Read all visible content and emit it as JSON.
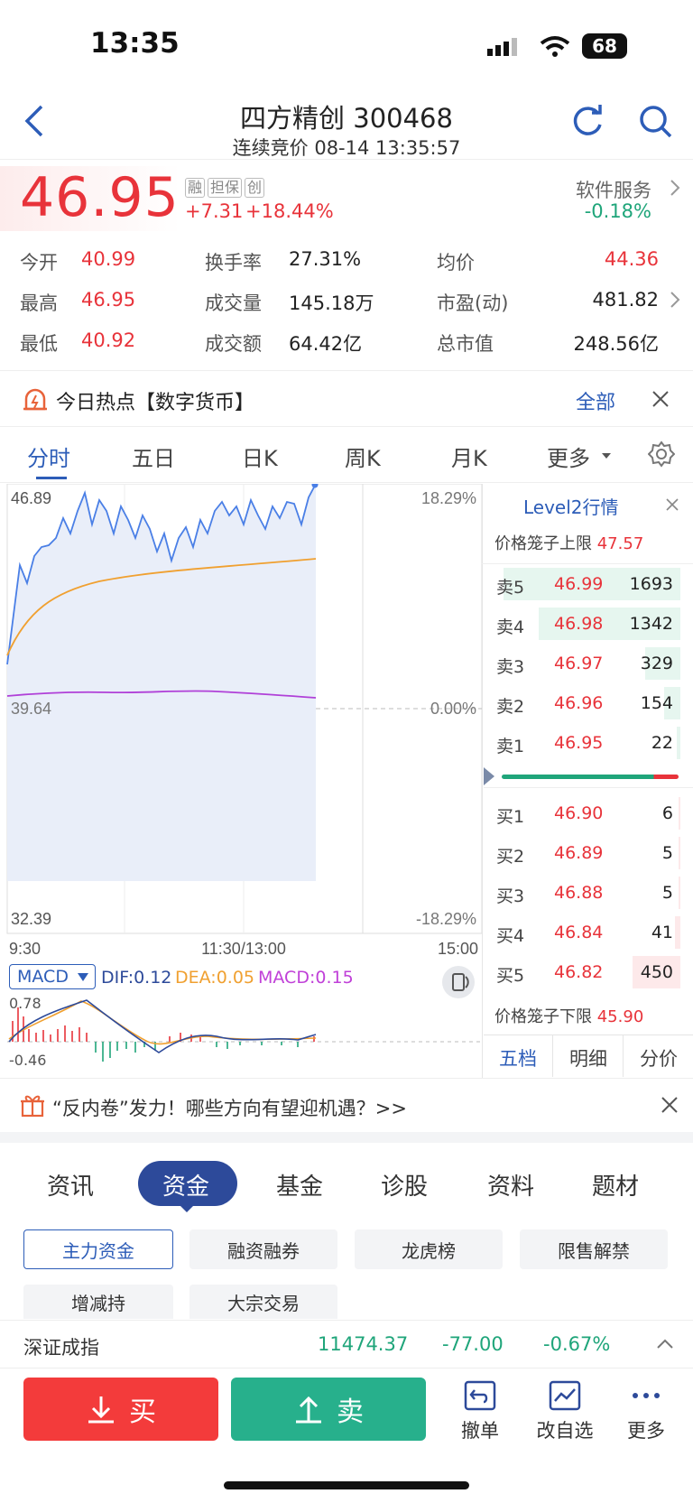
{
  "status_bar": {
    "time": "13:35",
    "battery": "68"
  },
  "header": {
    "title": "四方精创 300468",
    "subtitle": "连续竞价 08-14 13:35:57"
  },
  "quote": {
    "price": "46.95",
    "tags": [
      "融",
      "担保",
      "创"
    ],
    "change": "+7.31",
    "change_pct": "+18.44%",
    "sector": {
      "name": "软件服务",
      "change": "-0.18%"
    },
    "stats": [
      {
        "label": "今开",
        "value": "40.99"
      },
      {
        "label": "换手率",
        "value": "27.31%"
      },
      {
        "label": "均价",
        "value": "44.36"
      },
      {
        "label": "最高",
        "value": "46.95"
      },
      {
        "label": "成交量",
        "value": "145.18万"
      },
      {
        "label": "市盈(动)",
        "value": "481.82"
      },
      {
        "label": "最低",
        "value": "40.92"
      },
      {
        "label": "成交额",
        "value": "64.42亿"
      },
      {
        "label": "总市值",
        "value": "248.56亿"
      }
    ]
  },
  "hot": {
    "text": "今日热点【数字货币】",
    "all": "全部"
  },
  "chart_tabs": [
    "分时",
    "五日",
    "日K",
    "周K",
    "月K",
    "更多"
  ],
  "chart_data": {
    "type": "line",
    "title": "",
    "y_left": {
      "top": "46.89",
      "mid": "39.64",
      "bottom": "32.39"
    },
    "y_right": {
      "top": "18.29%",
      "mid": "0.00%",
      "bottom": "-18.29%"
    },
    "x_labels": [
      "9:30",
      "11:30/13:00",
      "15:00"
    ],
    "ylim": [
      32.39,
      46.89
    ],
    "series": []
  },
  "macd": {
    "selector": "MACD",
    "dif": "DIF:0.12",
    "dea": "DEA:0.05",
    "macd": "MACD:0.15",
    "top": "0.78",
    "bottom": "-0.46"
  },
  "orderbook": {
    "title": "Level2行情",
    "upper_limit_label": "价格笼子上限",
    "upper_limit": "47.57",
    "asks": [
      {
        "label": "卖5",
        "price": "46.99",
        "vol": "1693",
        "fill": 1.0
      },
      {
        "label": "卖4",
        "price": "46.98",
        "vol": "1342",
        "fill": 0.8
      },
      {
        "label": "卖3",
        "price": "46.97",
        "vol": "329",
        "fill": 0.2
      },
      {
        "label": "卖2",
        "price": "46.96",
        "vol": "154",
        "fill": 0.09
      },
      {
        "label": "卖1",
        "price": "46.95",
        "vol": "22",
        "fill": 0.02
      }
    ],
    "bids": [
      {
        "label": "买1",
        "price": "46.90",
        "vol": "6",
        "fill": 0.01
      },
      {
        "label": "买2",
        "price": "46.89",
        "vol": "5",
        "fill": 0.01
      },
      {
        "label": "买3",
        "price": "46.88",
        "vol": "5",
        "fill": 0.01
      },
      {
        "label": "买4",
        "price": "46.84",
        "vol": "41",
        "fill": 0.03
      },
      {
        "label": "买5",
        "price": "46.82",
        "vol": "450",
        "fill": 0.27
      }
    ],
    "lower_limit_label": "价格笼子下限",
    "lower_limit": "45.90",
    "tabs": [
      "五档",
      "明细",
      "分价"
    ]
  },
  "promo": {
    "text": "“反内卷”发力！哪些方向有望迎机遇？>>"
  },
  "info_tabs": [
    "资讯",
    "资金",
    "基金",
    "诊股",
    "资料",
    "题材"
  ],
  "chips": [
    "主力资金",
    "融资融券",
    "龙虎榜",
    "限售解禁",
    "增减持",
    "大宗交易"
  ],
  "index_bar": {
    "name": "深证成指",
    "value": "11474.37",
    "change": "-77.00",
    "pct": "-0.67%"
  },
  "actions": {
    "buy": "买",
    "sell": "卖",
    "cancel": "撤单",
    "watch": "改自选",
    "more": "更多"
  },
  "colors": {
    "up": "#e8333a",
    "down": "#1fa57a",
    "accent": "#2d5db8"
  }
}
